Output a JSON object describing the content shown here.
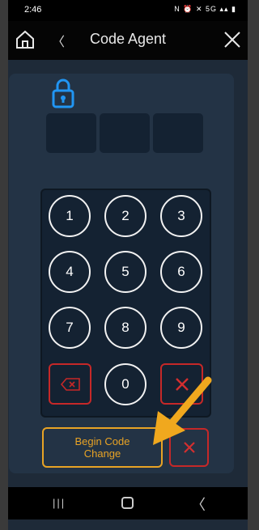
{
  "status": {
    "time": "2:46",
    "icons": "N ⏰ ✕ 5G ▴▴ ▮"
  },
  "header": {
    "title": "Code Agent",
    "back_label": "〈"
  },
  "keypad": {
    "keys": [
      "1",
      "2",
      "3",
      "4",
      "5",
      "6",
      "7",
      "8",
      "9",
      "0"
    ]
  },
  "actions": {
    "begin_line1": "Begin Code",
    "begin_line2": "Change"
  },
  "navbar": {
    "recents": "|||",
    "back": "〈"
  },
  "colors": {
    "accent": "#e8a325",
    "danger": "#c62828",
    "lock": "#2196f3",
    "panel": "#233345"
  }
}
